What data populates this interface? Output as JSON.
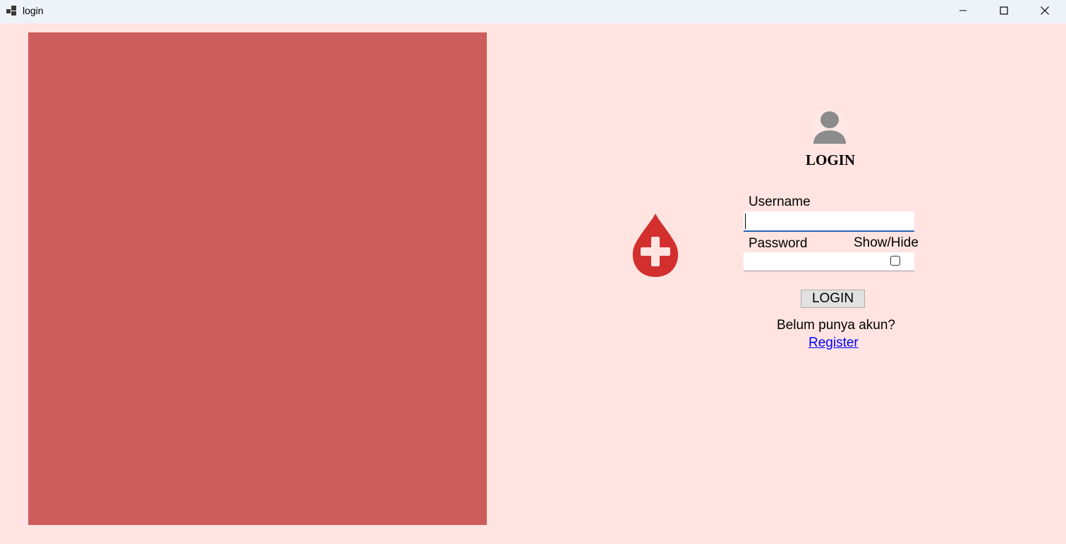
{
  "window": {
    "title": "login",
    "app_icon": "app-icon",
    "controls": {
      "minimize_icon": "minimize-icon",
      "maximize_icon": "maximize-icon",
      "close_icon": "close-icon"
    }
  },
  "colors": {
    "background": "#ffe4e1",
    "left_panel": "#cd5c5c",
    "blood_drop": "#d32f2f",
    "link": "#0000ff"
  },
  "logo": {
    "icon": "blood-donation-icon"
  },
  "form": {
    "avatar_icon": "user-icon",
    "title": "LOGIN",
    "username_label": "Username",
    "username_value": "",
    "password_label": "Password",
    "password_value": "",
    "show_hide_label": "Show/Hide",
    "show_hide_checked": false,
    "login_button": "LOGIN",
    "no_account_text": "Belum punya akun?",
    "register_link": "Register"
  }
}
